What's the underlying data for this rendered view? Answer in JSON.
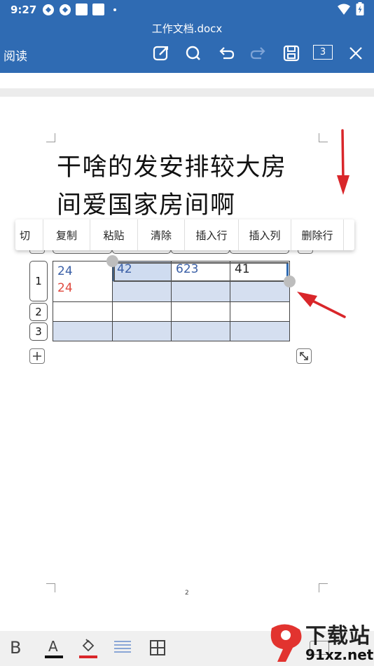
{
  "status": {
    "time": "9:27"
  },
  "appbar": {
    "title": "工作文档.docx",
    "mode_label": "阅读",
    "page_count_badge": "3"
  },
  "document": {
    "heading_line1": "干啥的发安排较大房",
    "heading_line2": "间爱国家房间啊",
    "page_number": "2",
    "table": {
      "row_labels": [
        "1",
        "2",
        "3"
      ],
      "rows": [
        {
          "a_blue": "24",
          "a_red": "24",
          "b": "42",
          "c": "623",
          "d": "41"
        },
        {
          "a": "",
          "b": "",
          "c": "",
          "d": ""
        },
        {
          "a": "",
          "b": "",
          "c": "",
          "d": ""
        }
      ]
    }
  },
  "context_menu": {
    "items": [
      "切",
      "复制",
      "粘贴",
      "清除",
      "插入行",
      "插入列",
      "删除行"
    ]
  },
  "bottom_toolbar": {
    "bold_label": "B",
    "font_color_label": "A"
  },
  "watermark": {
    "brand_big": "下载站",
    "brand_url": "91xz.net"
  },
  "colors": {
    "appbar": "#2f6bb3",
    "selection": "#d5dff0",
    "blue_text": "#3a5fa6",
    "red_text": "#e04a3f",
    "annotation_red": "#d9262a"
  }
}
